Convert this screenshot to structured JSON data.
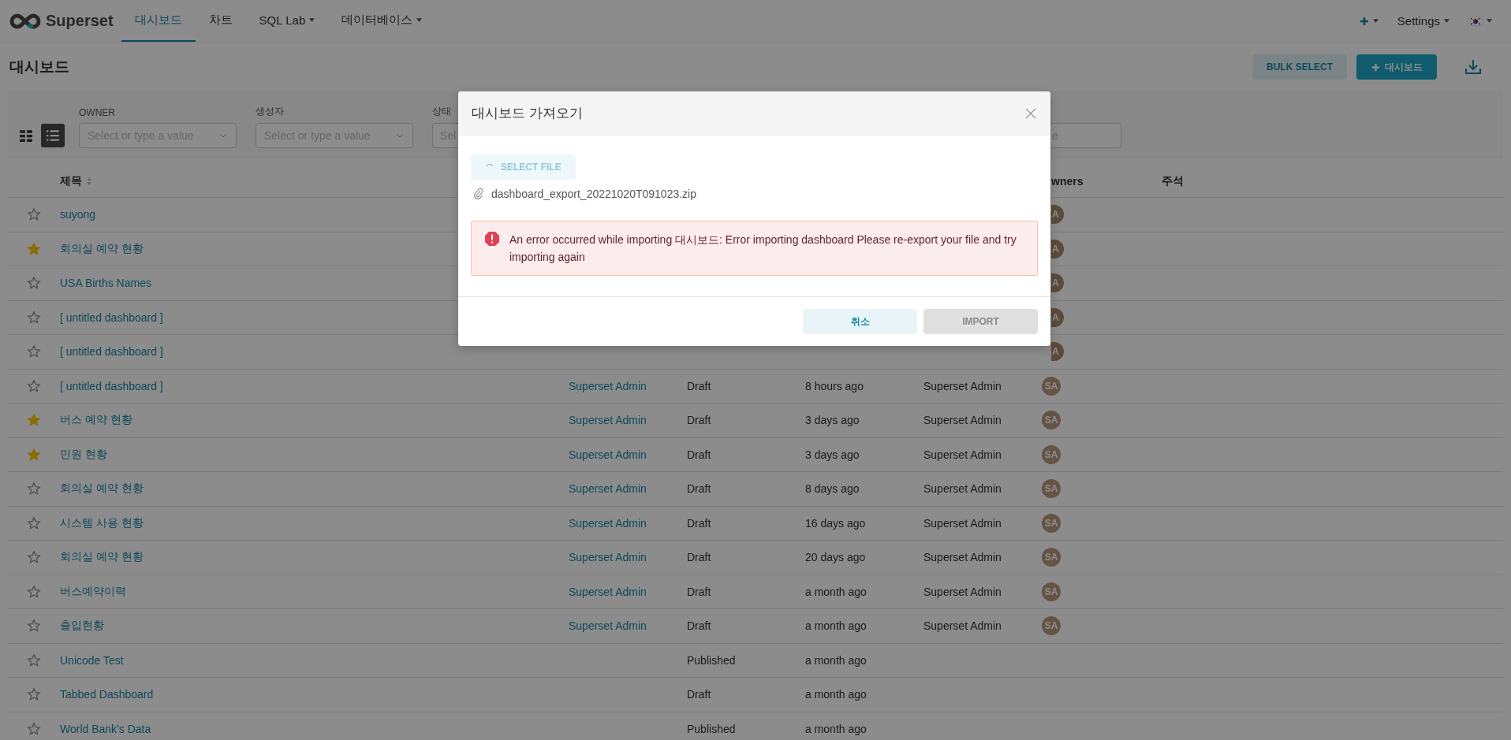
{
  "nav": {
    "brand": "Superset",
    "tabs": [
      {
        "label": "대시보드",
        "selected": true,
        "dropdown": false
      },
      {
        "label": "차트",
        "selected": false,
        "dropdown": false
      },
      {
        "label": "SQL Lab",
        "selected": false,
        "dropdown": true
      },
      {
        "label": "데이터베이스",
        "selected": false,
        "dropdown": true
      }
    ],
    "settings": "Settings"
  },
  "page": {
    "title": "대시보드",
    "bulk_select": "BULK SELECT",
    "add_button": "대시보드"
  },
  "view_toggle": [
    {
      "kind": "card",
      "selected": false
    },
    {
      "kind": "list",
      "selected": true
    }
  ],
  "filters": [
    {
      "label": "OWNER",
      "placeholder": "Select or type a value"
    },
    {
      "label": "생성자",
      "placeholder": "Select or type a value"
    },
    {
      "label": "상태",
      "placeholder": "Sel"
    }
  ],
  "search": {
    "placeholder": "e"
  },
  "table": {
    "columns": {
      "title": "제목",
      "owners": "wners",
      "notes": "주석"
    },
    "rows": [
      {
        "starred": false,
        "title": "suyong",
        "owner": {
          "kind": "partial",
          "initials": "A"
        }
      },
      {
        "starred": true,
        "title": "회의실 예약 현황",
        "owner": {
          "kind": "partial",
          "initials": "A"
        }
      },
      {
        "starred": false,
        "title": "USA Births Names",
        "owner": {
          "kind": "partial",
          "initials": "A"
        }
      },
      {
        "starred": false,
        "title": "[ untitled dashboard ]",
        "owner": {
          "kind": "partial",
          "initials": "A"
        }
      },
      {
        "starred": false,
        "title": "[ untitled dashboard ]",
        "owner": {
          "kind": "partial",
          "initials": "A"
        }
      },
      {
        "starred": false,
        "title": "[ untitled dashboard ]",
        "modified_by": "Superset Admin",
        "status": "Draft",
        "modified": "8 hours ago",
        "created_by": "Superset Admin",
        "owner": {
          "kind": "full",
          "initials": "SA"
        }
      },
      {
        "starred": true,
        "title": "버스 예약 현황",
        "modified_by": "Superset Admin",
        "status": "Draft",
        "modified": "3 days ago",
        "created_by": "Superset Admin",
        "owner": {
          "kind": "full",
          "initials": "SA"
        }
      },
      {
        "starred": true,
        "title": "민원 현황",
        "modified_by": "Superset Admin",
        "status": "Draft",
        "modified": "3 days ago",
        "created_by": "Superset Admin",
        "owner": {
          "kind": "full",
          "initials": "SA"
        }
      },
      {
        "starred": false,
        "title": "회의실 예약 현황",
        "modified_by": "Superset Admin",
        "status": "Draft",
        "modified": "8 days ago",
        "created_by": "Superset Admin",
        "owner": {
          "kind": "full",
          "initials": "SA"
        }
      },
      {
        "starred": false,
        "title": "시스템 사용 현황",
        "modified_by": "Superset Admin",
        "status": "Draft",
        "modified": "16 days ago",
        "created_by": "Superset Admin",
        "owner": {
          "kind": "full",
          "initials": "SA"
        }
      },
      {
        "starred": false,
        "title": "회의실 예약 현황",
        "modified_by": "Superset Admin",
        "status": "Draft",
        "modified": "20 days ago",
        "created_by": "Superset Admin",
        "owner": {
          "kind": "full",
          "initials": "SA"
        }
      },
      {
        "starred": false,
        "title": "버스예약이력",
        "modified_by": "Superset Admin",
        "status": "Draft",
        "modified": "a month ago",
        "created_by": "Superset Admin",
        "owner": {
          "kind": "full",
          "initials": "SA"
        }
      },
      {
        "starred": false,
        "title": "출입현황",
        "modified_by": "Superset Admin",
        "status": "Draft",
        "modified": "a month ago",
        "created_by": "Superset Admin",
        "owner": {
          "kind": "full",
          "initials": "SA"
        }
      },
      {
        "starred": false,
        "title": "Unicode Test",
        "status": "Published",
        "modified": "a month ago"
      },
      {
        "starred": false,
        "title": "Tabbed Dashboard",
        "status": "Draft",
        "modified": "a month ago"
      },
      {
        "starred": false,
        "title": "World Bank's Data",
        "status": "Published",
        "modified": "a month ago"
      }
    ]
  },
  "modal": {
    "title": "대시보드 가져오기",
    "select_file": "SELECT FILE",
    "loading": true,
    "file_name": "dashboard_export_20221020T091023.zip",
    "error": "An error occurred while importing 대시보드: Error importing dashboard Please re-export your file and try importing again",
    "cancel": "취소",
    "import": {
      "label": "IMPORT",
      "disabled": true
    }
  }
}
